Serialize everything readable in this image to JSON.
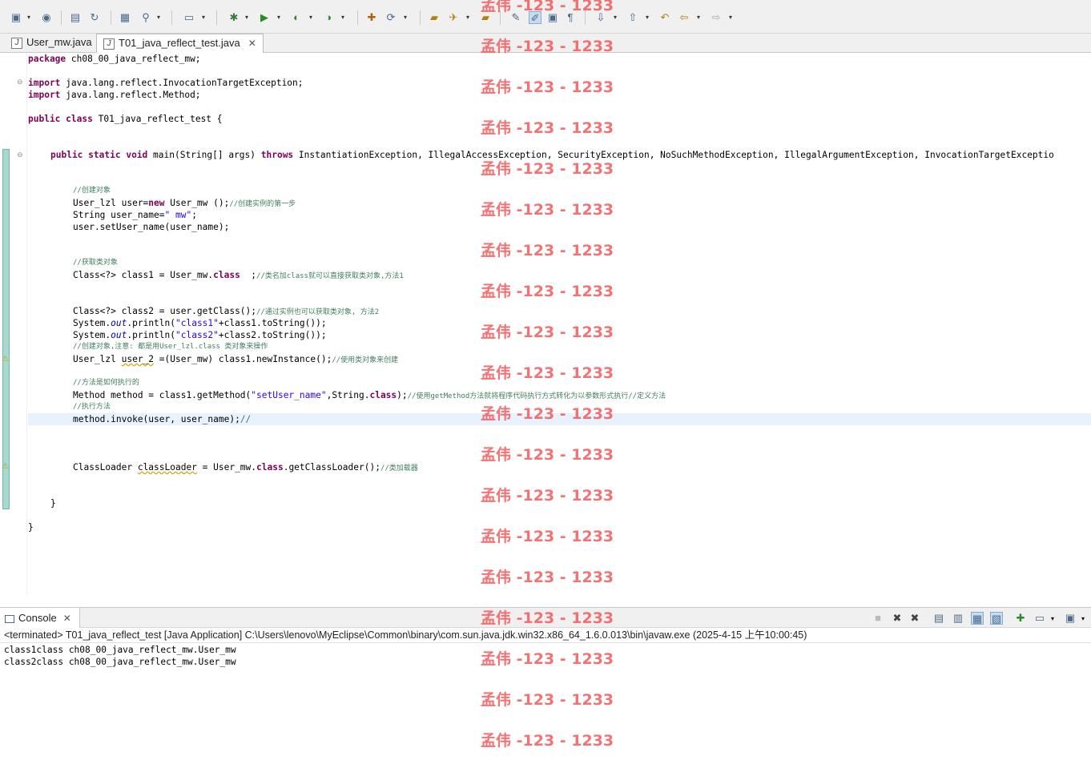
{
  "tabs": [
    {
      "label": "User_mw.java",
      "active": false
    },
    {
      "label": "T01_java_reflect_test.java",
      "active": true
    }
  ],
  "code": {
    "l_package": {
      "kw": "package",
      "rest": " ch08_00_java_reflect_mw;"
    },
    "l_import1": {
      "kw": "import",
      "rest": " java.lang.reflect.InvocationTargetException;"
    },
    "l_import2": {
      "kw": "import",
      "rest": " java.lang.reflect.Method;"
    },
    "l_class": {
      "kw1": "public",
      "kw2": "class",
      "rest": " T01_java_reflect_test {"
    },
    "l_main": {
      "kw1": "public",
      "kw2": "static",
      "kw3": "void",
      "mid": " main(String[] args) ",
      "kw4": "throws",
      "rest": " InstantiationException, IllegalAccessException, SecurityException, NoSuchMethodException, IllegalArgumentException, InvocationTargetExceptio"
    },
    "c_create": "//创建对象",
    "l_new": {
      "a": "User_lzl user=",
      "kw": "new",
      "b": " User_mw ();",
      "cm": "//创建实例的第一步"
    },
    "l_str": {
      "a": "String user_name=",
      "s": "\" mw\"",
      "b": ";"
    },
    "l_set": "user.setUser_name(user_name);",
    "c_get": "//获取类对象",
    "l_class1": {
      "a": "Class<?> class1 = User_mw.",
      "kw": "class",
      "b": "  ;",
      "cm": "//类名加class就可以直接获取类对象,方法1"
    },
    "l_class2": {
      "a": "Class<?> class2 = user.getClass();",
      "cm": "//通过实例也可以获取类对象, 方法2"
    },
    "l_print1": {
      "a": "System.",
      "fld": "out",
      "b": ".println(",
      "s": "\"class1\"",
      "c": "+class1.toString());"
    },
    "l_print2": {
      "a": "System.",
      "fld": "out",
      "b": ".println(",
      "s": "\"class2\"",
      "c": "+class2.toString());"
    },
    "c_note": "//创建对象,注意: 都是用User_lzl.class 类对象来操作",
    "l_inst": {
      "a": "User_lzl ",
      "warn": "user_2",
      "b": " =(User_mw) class1.newInstance();",
      "cm": "//使用类对象来创建"
    },
    "c_exec": "//方法是如何执行的",
    "l_method": {
      "a": "Method method = class1.getMethod(",
      "s": "\"setUser_name\"",
      "b": ",String.",
      "kw": "class",
      "c": ");",
      "cm": "//使用getMethod方法就将程序代码执行方式转化为以参数形式执行//定义方法"
    },
    "c_run": "//执行方法",
    "l_invoke": {
      "a": "method.invoke(user, user_name);",
      "cm": "//"
    },
    "l_loader": {
      "a": "ClassLoader ",
      "warn": "classLoader",
      "b": " = User_mw.",
      "kw": "class",
      "c": ".getClassLoader();",
      "cm": "//类加载器"
    },
    "l_close_method": "}",
    "l_close_class": "}"
  },
  "console": {
    "tab_label": "Console",
    "status": "<terminated> T01_java_reflect_test [Java Application] C:\\Users\\lenovo\\MyEclipse\\Common\\binary\\com.sun.java.jdk.win32.x86_64_1.6.0.013\\bin\\javaw.exe (2025-4-15 上午10:00:45)",
    "output": [
      "class1class ch08_00_java_reflect_mw.User_mw",
      "class2class ch08_00_java_reflect_mw.User_mw"
    ]
  },
  "watermark": "孟伟 -123 - 1233",
  "icons": {
    "toolbar": [
      "new-icon",
      "globe-icon",
      "open-icon",
      "refresh-icon",
      "wizard-icon",
      "search-icon",
      "screen-icon",
      "debug-icon",
      "run-icon",
      "run-ext-icon",
      "coverage-icon",
      "package-icon",
      "sync-icon",
      "folder-open-icon",
      "deploy-icon",
      "browse-icon",
      "marker-icon",
      "highlight-icon",
      "block-icon",
      "paragraph-icon",
      "next-annotation-icon",
      "prev-annotation-icon",
      "last-edit-icon",
      "back-icon",
      "forward-icon"
    ],
    "console": [
      "terminate-icon",
      "remove-launch-icon",
      "remove-all-icon",
      "clear-icon",
      "scroll-lock-icon",
      "word-wrap-icon",
      "show-on-output-icon",
      "pin-icon",
      "new-console-icon",
      "display-console-icon",
      "open-console-icon",
      "view-menu-icon"
    ]
  }
}
